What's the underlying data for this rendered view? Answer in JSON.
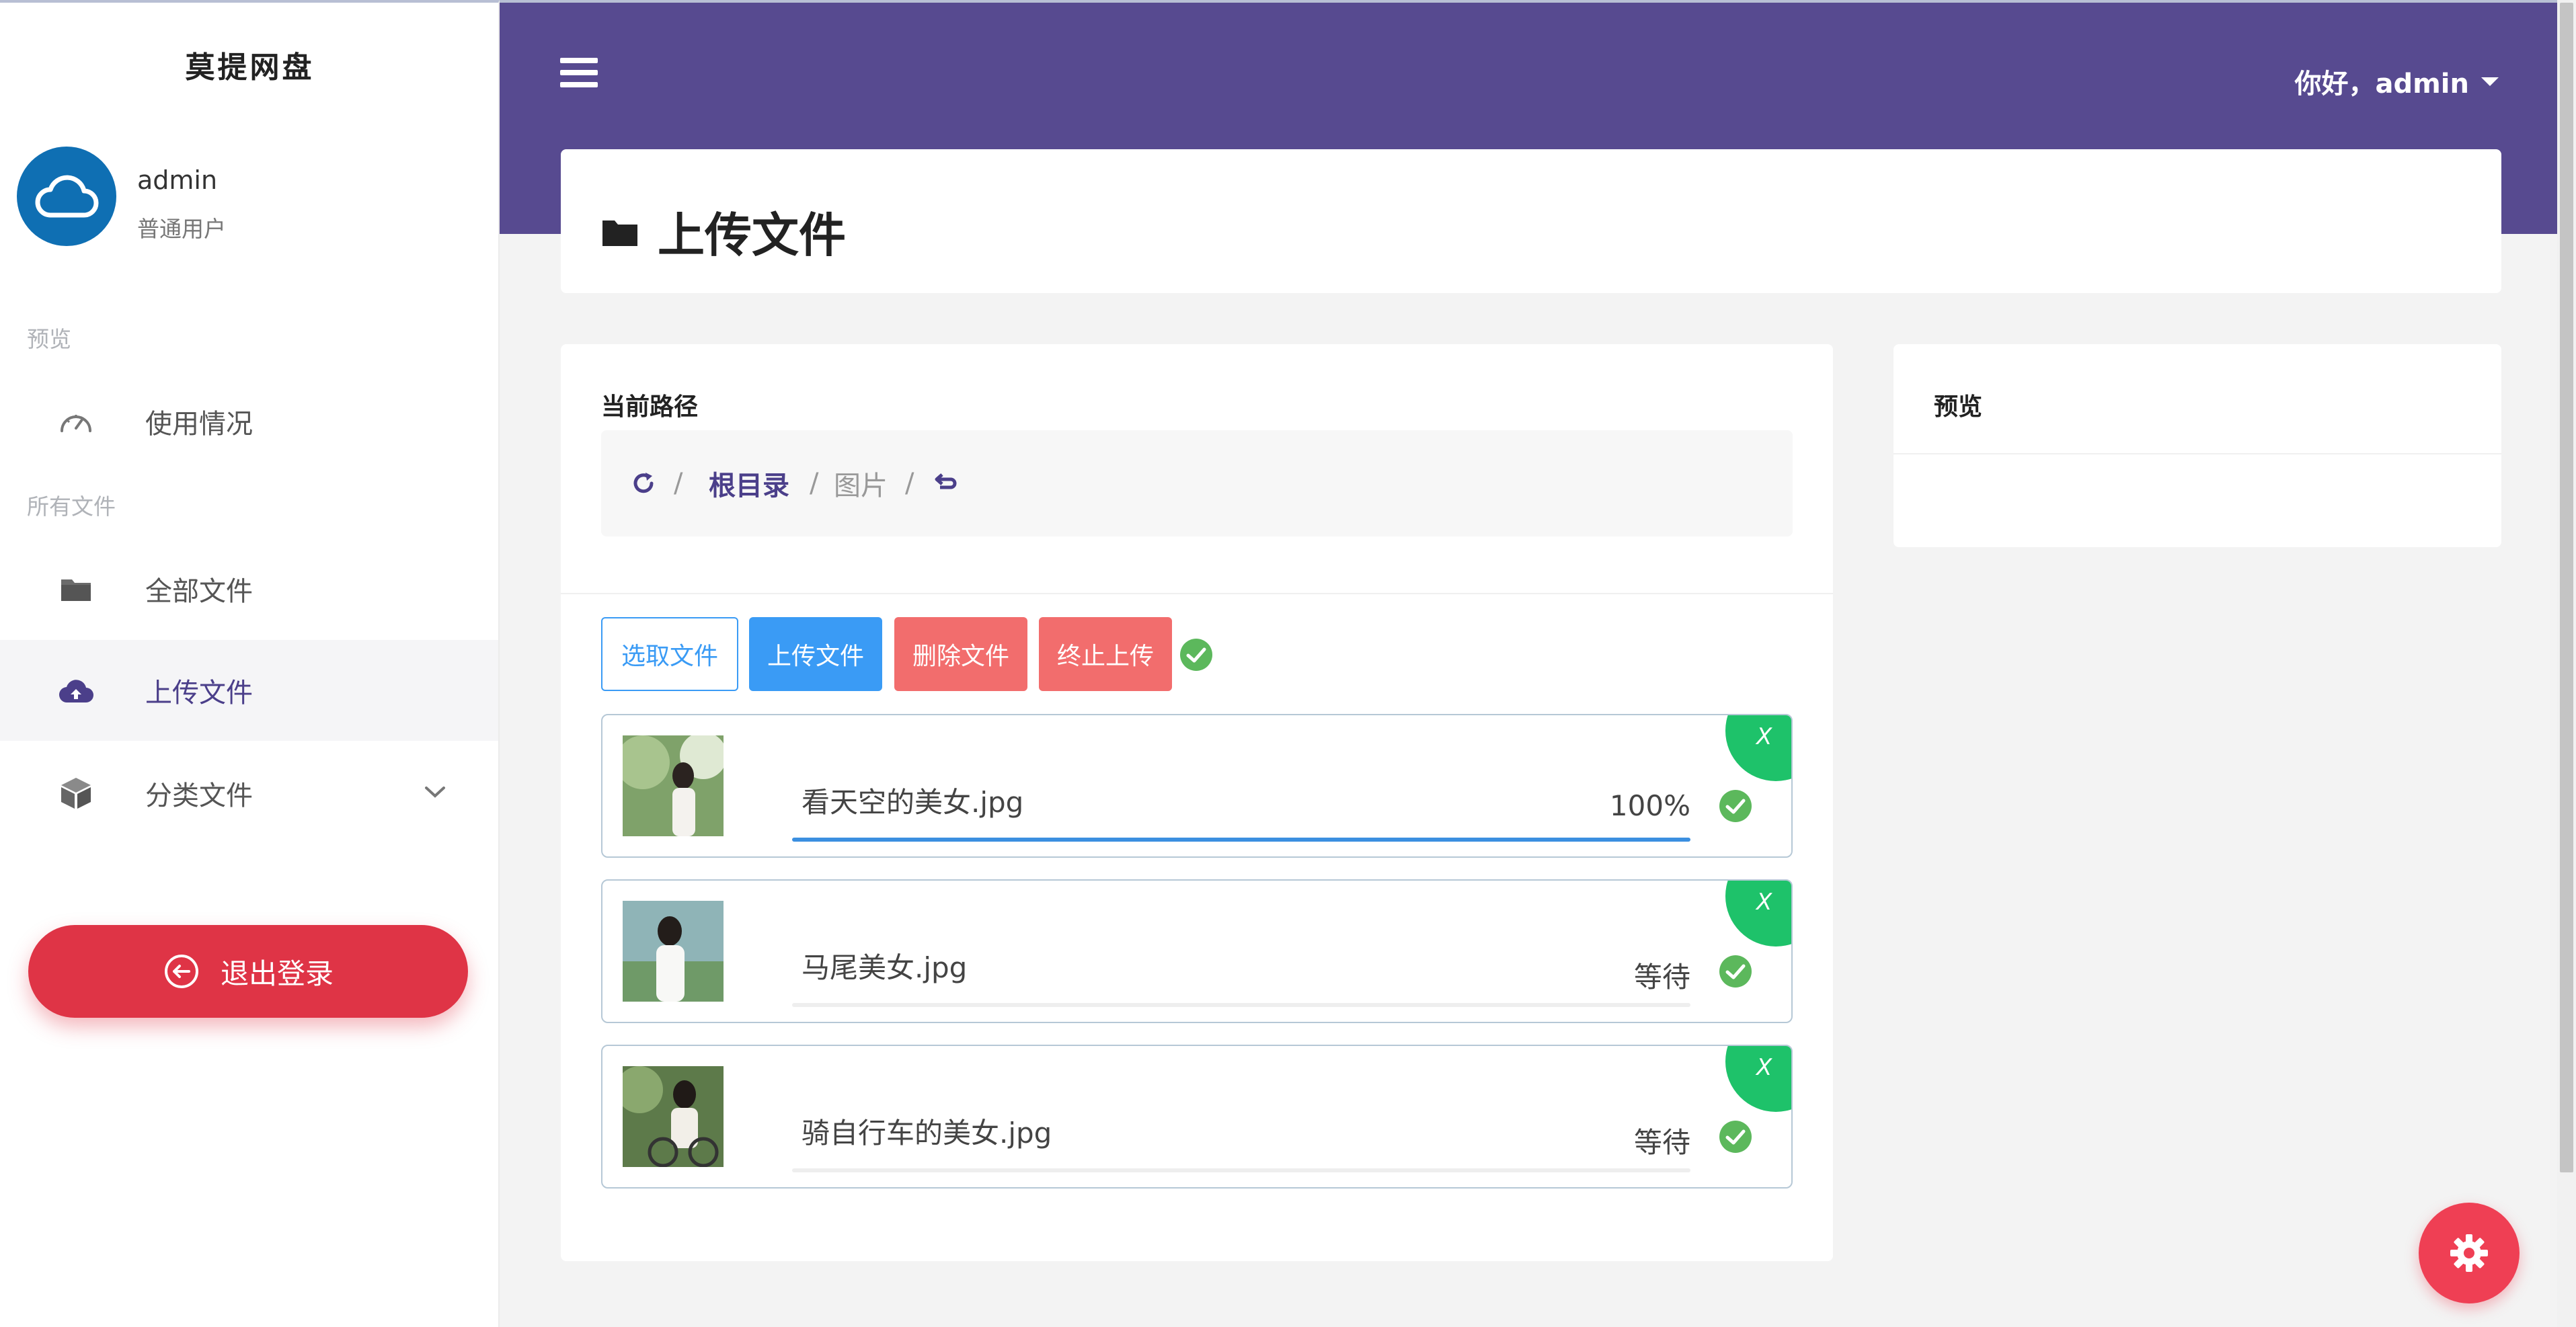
{
  "sidebar": {
    "brand": "莫提网盘",
    "user": {
      "name": "admin",
      "role": "普通用户"
    },
    "sections": {
      "preview": "预览",
      "files": "所有文件"
    },
    "items": [
      {
        "label": "使用情况",
        "icon": "speedometer-icon"
      },
      {
        "label": "全部文件",
        "icon": "folder-icon"
      },
      {
        "label": "上传文件",
        "icon": "cloud-upload-icon",
        "active": true
      },
      {
        "label": "分类文件",
        "icon": "cube-icon"
      }
    ],
    "logout_label": "退出登录"
  },
  "topbar": {
    "greeting": "你好，admin"
  },
  "page": {
    "title": "上传文件"
  },
  "path": {
    "label": "当前路径",
    "crumbs": [
      "根目录",
      "图片"
    ],
    "separator": "/"
  },
  "toolbar": {
    "select": "选取文件",
    "upload": "上传文件",
    "delete": "删除文件",
    "stop": "终止上传"
  },
  "files": [
    {
      "name": "看天空的美女.jpg",
      "status": "100%",
      "progress": 1.0
    },
    {
      "name": "马尾美女.jpg",
      "status": "等待",
      "progress": 0
    },
    {
      "name": "骑自行车的美女.jpg",
      "status": "等待",
      "progress": 0
    }
  ],
  "file_remove_label": "X",
  "preview": {
    "title": "预览"
  },
  "colors": {
    "header": "#574a90",
    "accent": "#4b3f8a",
    "upload_button": "#3a9bf5",
    "danger_button": "#f26d6d",
    "logout": "#df3446",
    "success": "#5cb85c",
    "badge": "#1ec26a"
  }
}
